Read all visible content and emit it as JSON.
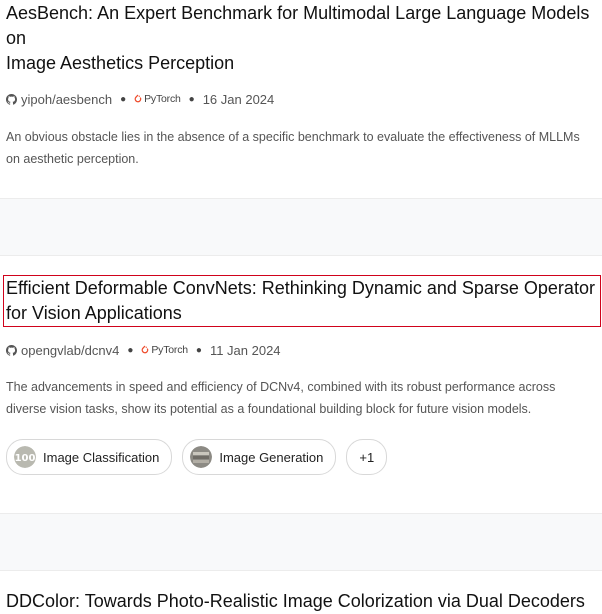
{
  "papers": [
    {
      "title_line1": "AesBench: An Expert Benchmark for Multimodal Large Language Models on",
      "title_line2": "Image Aesthetics Perception",
      "repo": "yipoh/aesbench",
      "framework": "PyTorch",
      "date": "16 Jan 2024",
      "abstract_line1": "An obvious obstacle lies in the absence of a specific benchmark to evaluate the effectiveness of MLLMs",
      "abstract_line2": "on aesthetic perception."
    },
    {
      "title_line1": "Efficient Deformable ConvNets: Rethinking Dynamic and Sparse Operator",
      "title_line2": "for Vision Applications",
      "repo": "opengvlab/dcnv4",
      "framework": "PyTorch",
      "date": "11 Jan 2024",
      "abstract_line1": "The advancements in speed and efficiency of DCNv4, combined with its robust performance across",
      "abstract_line2": "diverse vision tasks, show its potential as a foundational building block for future vision models.",
      "tags": [
        "Image Classification",
        "Image Generation"
      ],
      "more_tags": "+1"
    },
    {
      "title_line1": "DDColor: Towards Photo-Realistic Image Colorization via Dual Decoders"
    }
  ],
  "colors": {
    "highlight": "#d0021b",
    "framework": "#ee4c2c",
    "band": "#f8f9fa"
  },
  "icons": {
    "repo": "github-icon",
    "framework": "pytorch-flame-icon"
  }
}
